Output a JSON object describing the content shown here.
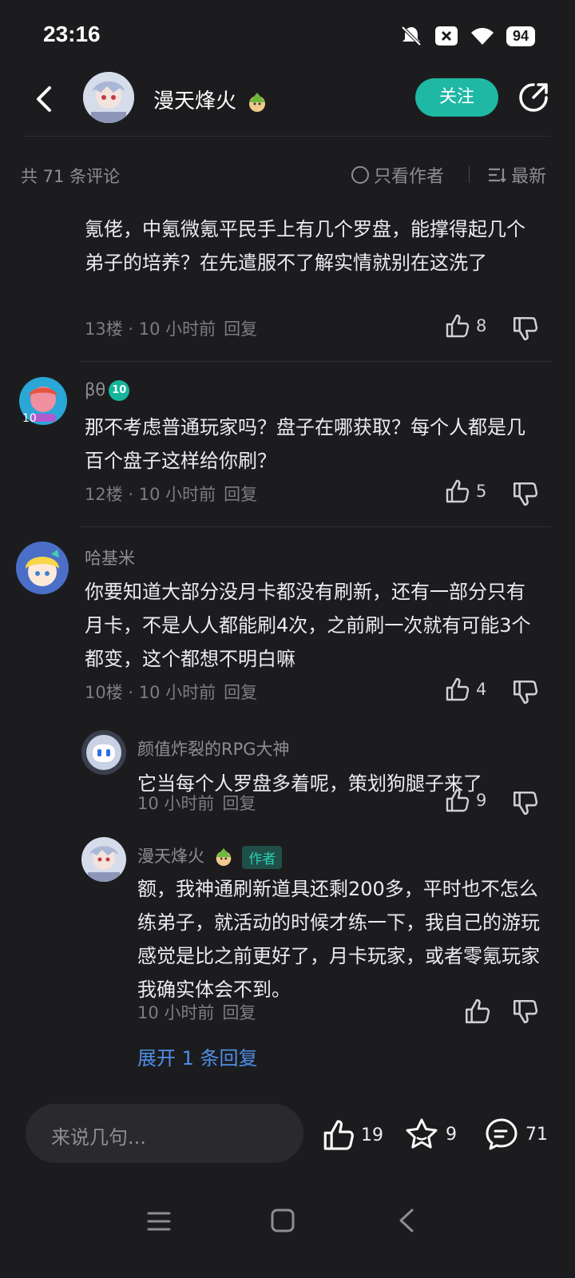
{
  "status_bar": {
    "time": "23:16",
    "battery": "94"
  },
  "header": {
    "author_name": "漫天烽火",
    "follow_label": "关注"
  },
  "toolbar": {
    "comment_count": "共 71 条评论",
    "author_only": "只看作者",
    "sort": "最新"
  },
  "comments": [
    {
      "text": "氪佬，中氪微氪平民手上有几个罗盘，能撑得起几个弟子的培养？在先遣服不了解实情就别在这洗了",
      "floor": "13楼 · 10 小时前",
      "reply": "回复",
      "likes": "8"
    },
    {
      "user": "βθ",
      "level": "10",
      "text": "那不考虑普通玩家吗？盘子在哪获取？每个人都是几百个盘子这样给你刷？",
      "floor": "12楼 · 10 小时前",
      "reply": "回复",
      "likes": "5"
    },
    {
      "user": "哈基米",
      "text": "你要知道大部分没月卡都没有刷新，还有一部分只有月卡，不是人人都能刷4次，之前刷一次就有可能3个都变，这个都想不明白嘛",
      "floor": "10楼 · 10 小时前",
      "reply": "回复",
      "likes": "4",
      "replies": [
        {
          "user": "颜值炸裂的RPG大神",
          "text": "它当每个人罗盘多着呢，策划狗腿子来了",
          "time": "10 小时前",
          "reply": "回复",
          "likes": "9"
        },
        {
          "user": "漫天烽火",
          "tag": "作者",
          "text": "额，我神通刷新道具还剩200多，平时也不怎么练弟子，就活动的时候才练一下，我自己的游玩感觉是比之前更好了，月卡玩家，或者零氪玩家我确实体会不到。",
          "time": "10 小时前",
          "reply": "回复"
        }
      ],
      "expand": "展开 1 条回复"
    }
  ],
  "bottom_bar": {
    "placeholder": "来说几句...",
    "likes": "19",
    "favorites": "9",
    "comments": "71"
  }
}
